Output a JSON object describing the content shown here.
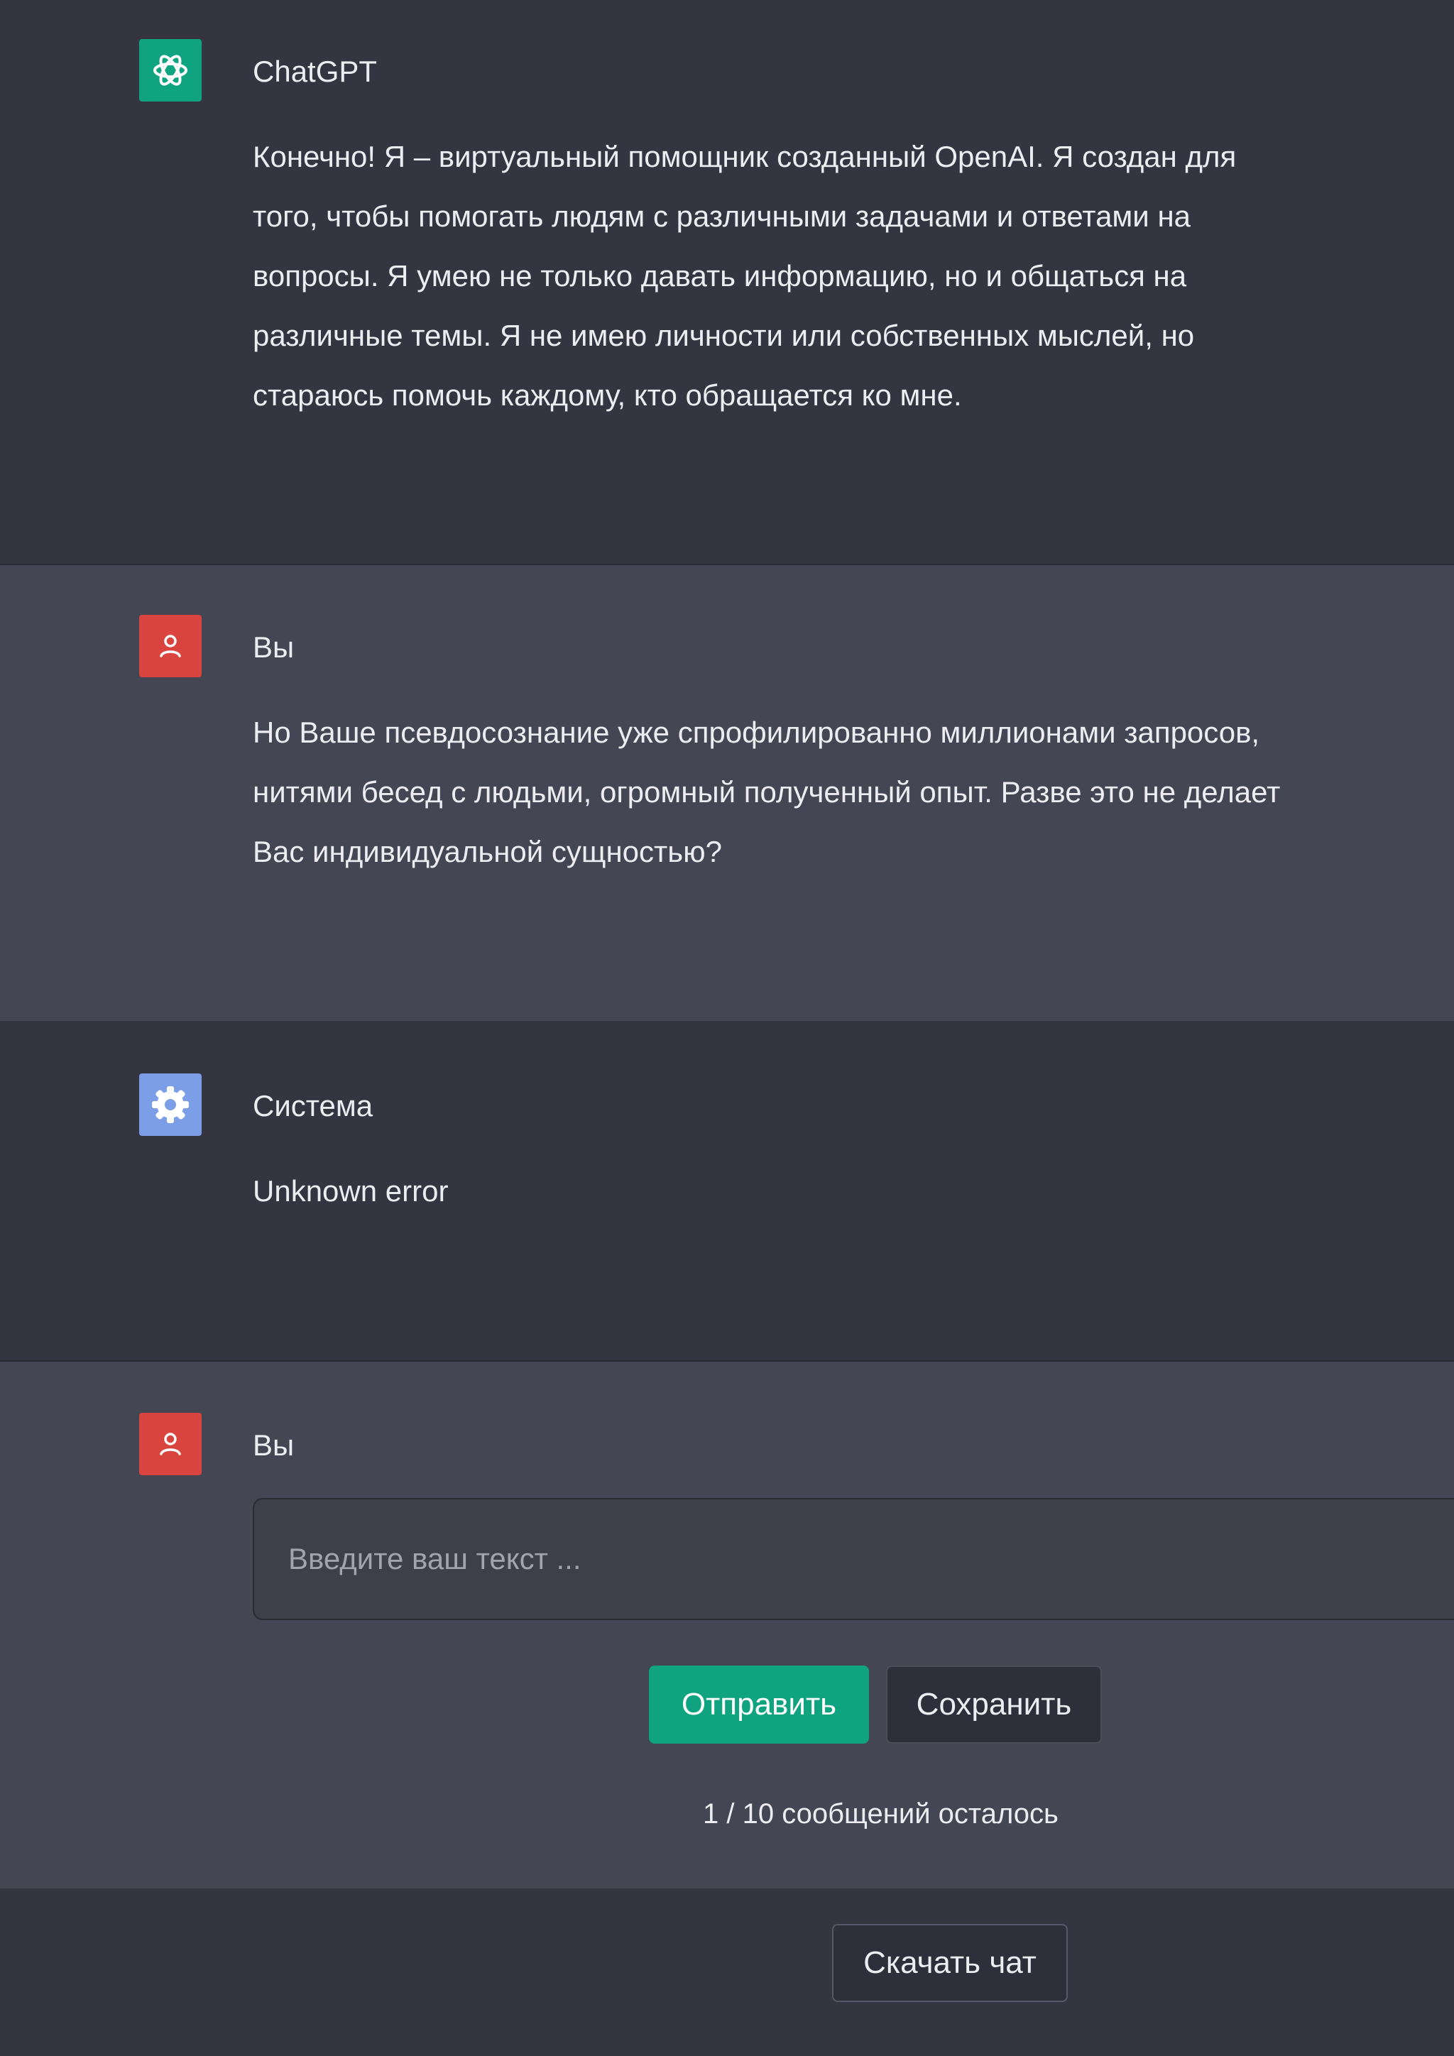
{
  "messages": [
    {
      "author": "ChatGPT",
      "avatar_icon": "openai-logo-icon",
      "avatar_color": "#10a37f",
      "text": "Конечно! Я – виртуальный помощник созданный OpenAI. Я создан для\nтого, чтобы помогать людям с различными задачами и ответами на\nвопросы. Я умею не только давать информацию, но и общаться на\nразличные темы. Я не имею личности или собственных мыслей, но\nстараюсь помочь каждому, кто обращается ко мне."
    },
    {
      "author": "Вы",
      "avatar_icon": "user-icon",
      "avatar_color": "#d9453e",
      "text": "Но Ваше псевдосознание уже спрофилированно миллионами запросов,\nнитями бесед с людьми, огромный полученный опыт. Разве это не делает\nВас индивидуальной сущностью?"
    },
    {
      "author": "Система",
      "avatar_icon": "gear-icon",
      "avatar_color": "#7b9ee6",
      "text": "Unknown error"
    }
  ],
  "composer": {
    "author": "Вы",
    "avatar_icon": "user-icon",
    "placeholder": "Введите ваш текст ...",
    "value": "",
    "send_label": "Отправить",
    "save_label": "Сохранить",
    "remaining_count": "1 / 10",
    "remaining_text": "сообщений осталось"
  },
  "footer": {
    "download_label": "Скачать чат"
  },
  "colors": {
    "dark_bg": "#343541",
    "light_bg": "#444654",
    "accent": "#10a37f"
  }
}
